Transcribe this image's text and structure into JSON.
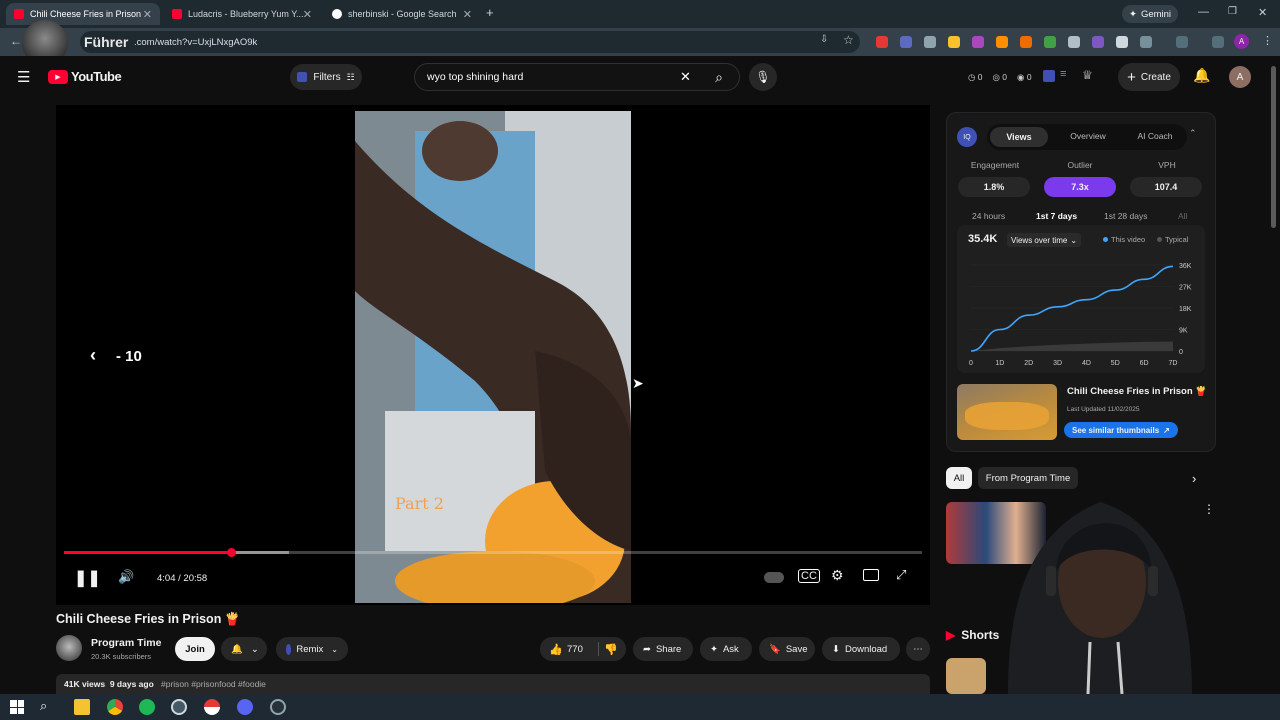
{
  "browser": {
    "tabs": [
      {
        "title": "Chili Cheese Fries in Prison",
        "active": true
      },
      {
        "title": "Ludacris - Blueberry Yum Y..."
      },
      {
        "title": "sherbinski - Google Search"
      }
    ],
    "gemini_label": "Gemini",
    "url": ".com/watch?v=UxjLNxgAO9k",
    "overlay_text": "Führer",
    "avatar_letter": "A"
  },
  "youtube": {
    "logo_text": "YouTube",
    "filters_label": "Filters",
    "search_value": "wyo top shining hard",
    "stats": [
      "0",
      "0",
      "0"
    ],
    "create_label": "Create",
    "account_letter": "A"
  },
  "player": {
    "skip_back_label": "- 10",
    "video_caption": "Part 2",
    "time": "4:04 / 20:58",
    "progress": 0.195,
    "buffer": 0.262
  },
  "video": {
    "title": "Chili Cheese Fries in Prison 🍟",
    "channel": "Program Time",
    "subscribers": "20.3K subscribers",
    "join_label": "Join",
    "remix_label": "Remix",
    "likes": "770",
    "share_label": "Share",
    "ask_label": "Ask",
    "save_label": "Save",
    "download_label": "Download",
    "meta": "41K views  9 days ago",
    "hashtags": "#prison #prisonfood #foodie"
  },
  "panel": {
    "tabs": [
      "Views",
      "Overview",
      "AI Coach"
    ],
    "metrics": [
      {
        "label": "Engagement",
        "value": "1.8%"
      },
      {
        "label": "Outlier",
        "value": "7.3x"
      },
      {
        "label": "VPH",
        "value": "107.4"
      }
    ],
    "time_ranges": [
      "24 hours",
      "1st 7 days",
      "1st 28 days",
      "All"
    ],
    "total": "35.4K",
    "dropdown": "Views over time",
    "legend_this": "This video",
    "legend_typical": "Typical",
    "card_title": "Chili Cheese Fries in Prison 🍟",
    "card_updated": "Last Updated 11/02/2025",
    "card_button": "See similar thumbnails"
  },
  "chart_data": {
    "type": "line",
    "x": [
      0,
      10,
      20,
      30,
      40,
      50,
      60,
      70
    ],
    "xticks": [
      "0",
      "1D",
      "2D",
      "3D",
      "4D",
      "5D",
      "6D",
      "7D"
    ],
    "yticks": [
      "36K",
      "27K",
      "18K",
      "9K",
      "0"
    ],
    "ylim": [
      0,
      36000
    ],
    "series": [
      {
        "name": "This video",
        "values": [
          0,
          9000,
          15000,
          18500,
          21500,
          25500,
          30000,
          35400
        ],
        "color": "#3ea6ff"
      },
      {
        "name": "Typical",
        "values": [
          0,
          1200,
          2000,
          2600,
          3100,
          3500,
          3800,
          4000
        ],
        "color": "#3a3a3a"
      }
    ]
  },
  "related": {
    "chips": [
      "All",
      "From Program Time"
    ],
    "shorts_label": "Shorts"
  },
  "colors": {
    "accent_red": "#ff0033",
    "outlier_purple": "#7c3aed",
    "link_blue": "#3ea6ff"
  }
}
